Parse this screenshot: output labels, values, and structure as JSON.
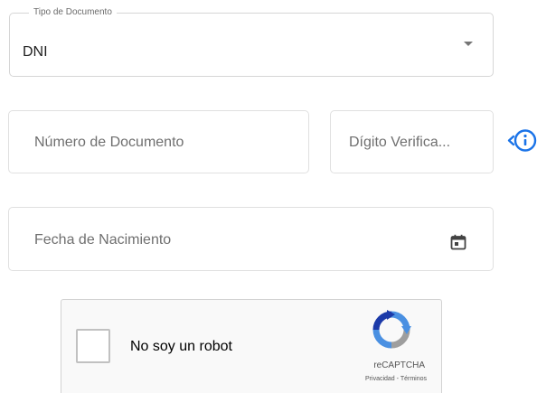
{
  "document_type": {
    "label": "Tipo de Documento",
    "value": "DNI",
    "icon": "chevron-down-icon"
  },
  "document_number": {
    "placeholder": "Número de Documento"
  },
  "check_digit": {
    "placeholder": "Dígito Verifica...",
    "info_icon": "info-icon"
  },
  "birth_date": {
    "placeholder": "Fecha de Nacimiento",
    "icon": "calendar-icon"
  },
  "captcha": {
    "label": "No soy un robot",
    "brand": "reCAPTCHA",
    "privacy_link": "Privacidad",
    "separator": " - ",
    "terms_link": "Términos"
  },
  "colors": {
    "info_icon": "#1a73e8",
    "recaptcha_blue": "#4a90e2",
    "recaptcha_gray": "#9e9e9e"
  }
}
